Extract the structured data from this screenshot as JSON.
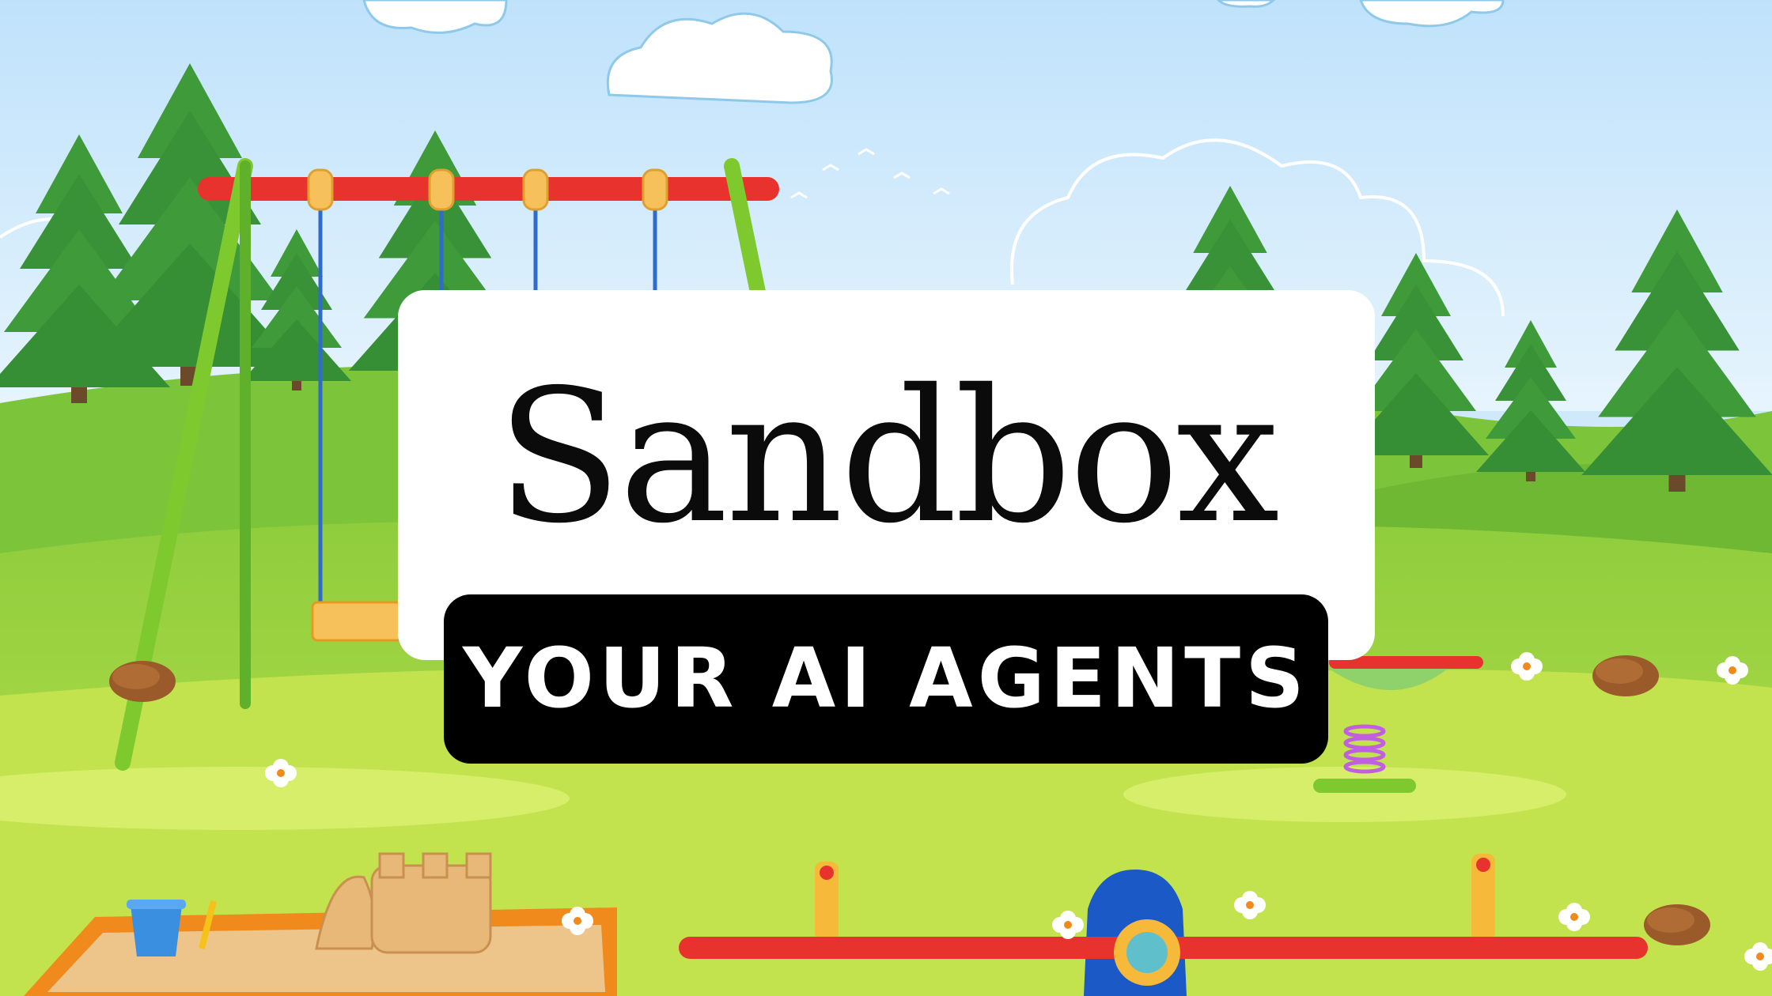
{
  "title": "Sandbox",
  "tagline": "YOUR AI AGENTS",
  "colors": {
    "sky_top": "#bfe2fb",
    "sky_bottom": "#e6f4fd",
    "grass_far": "#7cc43a",
    "grass_near": "#bde14c",
    "tree": "#3f9a3a",
    "swing_frame": "#7ec92d",
    "swing_bar": "#e8322d",
    "seesaw_base": "#1b59c7",
    "sand": "#edc58a",
    "sandbox_frame": "#f08a1c",
    "card_white": "#ffffff",
    "card_black": "#000000"
  },
  "icons": [
    "cloud-icon",
    "pine-tree-icon",
    "swing-set-icon",
    "seesaw-icon",
    "spring-rider-icon",
    "sandbox-icon",
    "sandcastle-icon",
    "bucket-icon",
    "flower-icon",
    "rock-icon",
    "bird-icon"
  ]
}
